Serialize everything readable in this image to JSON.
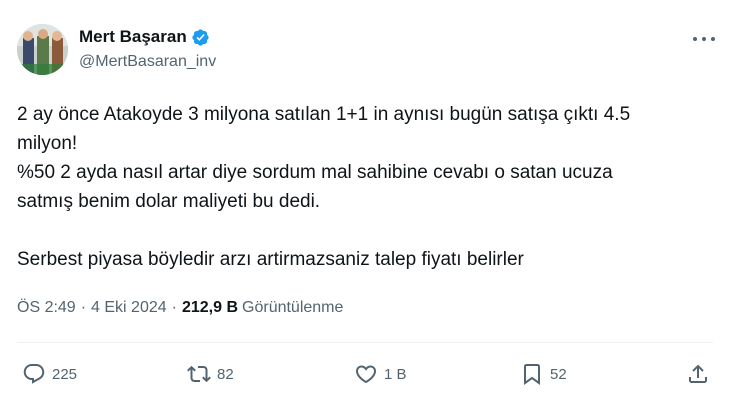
{
  "author": {
    "display_name": "Mert Başaran",
    "handle": "@MertBasaran_inv",
    "verified": true,
    "verified_color": "#1d9bf0"
  },
  "tweet": {
    "lines": [
      "2 ay önce Atakoyde 3 milyona satılan 1+1 in aynısı bugün satışa çıktı 4.5",
      "milyon!",
      "%50 2 ayda nasıl artar diye sordum mal sahibine cevabı o satan ucuza",
      "satmış benim dolar maliyeti bu dedi.",
      "Serbest piyasa böyledir arzı artirmazsaniz talep fiyatı belirler"
    ]
  },
  "meta": {
    "time": "ÖS 2:49",
    "separator": "·",
    "date": "4 Eki 2024",
    "views_count": "212,9 B",
    "views_label": "Görüntülenme"
  },
  "actions": {
    "reply_count": "225",
    "repost_count": "82",
    "like_count": "1 B",
    "bookmark_count": "52"
  },
  "icons": {
    "more": "more-options-icon",
    "reply": "reply-icon",
    "repost": "repost-icon",
    "like": "like-icon",
    "bookmark": "bookmark-icon",
    "share": "share-icon",
    "verified": "verified-badge-icon"
  },
  "colors": {
    "text_primary": "#0f1419",
    "text_secondary": "#536471",
    "divider": "#eff3f4"
  }
}
